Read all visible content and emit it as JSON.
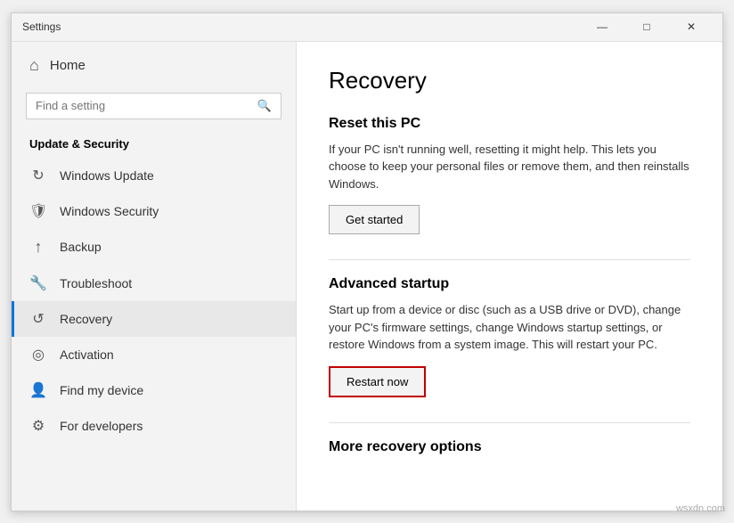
{
  "window": {
    "title": "Settings",
    "controls": {
      "minimize": "—",
      "maximize": "□",
      "close": "✕"
    }
  },
  "sidebar": {
    "home_label": "Home",
    "search_placeholder": "Find a setting",
    "section_title": "Update & Security",
    "items": [
      {
        "id": "windows-update",
        "label": "Windows Update",
        "icon": "↻"
      },
      {
        "id": "windows-security",
        "label": "Windows Security",
        "icon": "🛡"
      },
      {
        "id": "backup",
        "label": "Backup",
        "icon": "↑"
      },
      {
        "id": "troubleshoot",
        "label": "Troubleshoot",
        "icon": "🔑"
      },
      {
        "id": "recovery",
        "label": "Recovery",
        "icon": "↺",
        "active": true
      },
      {
        "id": "activation",
        "label": "Activation",
        "icon": "⊙"
      },
      {
        "id": "find-my-device",
        "label": "Find my device",
        "icon": "👤"
      },
      {
        "id": "for-developers",
        "label": "For developers",
        "icon": "⚙"
      }
    ]
  },
  "main": {
    "page_title": "Recovery",
    "sections": [
      {
        "id": "reset-pc",
        "title": "Reset this PC",
        "description": "If your PC isn't running well, resetting it might help. This lets you choose to keep your personal files or remove them, and then reinstalls Windows.",
        "button_label": "Get started"
      },
      {
        "id": "advanced-startup",
        "title": "Advanced startup",
        "description": "Start up from a device or disc (such as a USB drive or DVD), change your PC's firmware settings, change Windows startup settings, or restore Windows from a system image. This will restart your PC.",
        "button_label": "Restart now",
        "button_highlighted": true
      },
      {
        "id": "more-recovery",
        "title": "More recovery options",
        "description": ""
      }
    ]
  },
  "watermark": "wsxdn.com"
}
